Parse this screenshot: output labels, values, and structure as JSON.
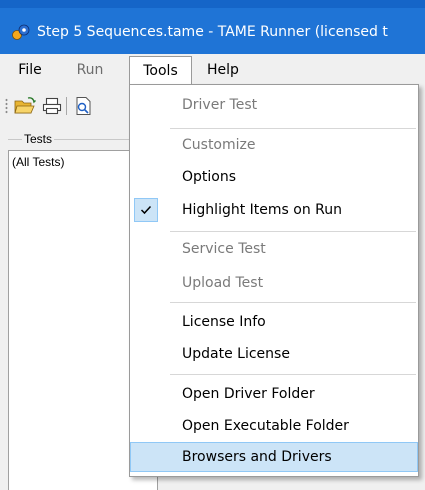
{
  "window": {
    "title": "Step 5 Sequences.tame - TAME Runner (licensed t",
    "icon": "tame-app-icon"
  },
  "menubar": {
    "items": [
      {
        "label": "File",
        "disabled": false
      },
      {
        "label": "Run",
        "disabled": true
      },
      {
        "label": "Tools",
        "open": true
      },
      {
        "label": "Help",
        "disabled": false
      }
    ]
  },
  "toolbar": {
    "buttons": [
      "open-folder-icon",
      "print-icon",
      "find-icon"
    ]
  },
  "tests_panel": {
    "group_label": "Tests",
    "list_items": [
      "(All Tests)"
    ]
  },
  "tools_menu": {
    "items": [
      {
        "label": "Driver Test",
        "disabled": true
      },
      {
        "label": "Customize",
        "disabled": true
      },
      {
        "label": "Options",
        "disabled": false
      },
      {
        "label": "Highlight Items on Run",
        "disabled": false,
        "checked": true
      },
      {
        "label": "Service Test",
        "disabled": true
      },
      {
        "label": "Upload Test",
        "disabled": true
      },
      {
        "label": "License Info",
        "disabled": false
      },
      {
        "label": "Update License",
        "disabled": false
      },
      {
        "label": "Open Driver Folder",
        "disabled": false
      },
      {
        "label": "Open Executable Folder",
        "disabled": false
      },
      {
        "label": "Browsers and Drivers",
        "disabled": false,
        "highlighted": true
      }
    ]
  },
  "colors": {
    "titlebar": "#1f74d6",
    "menu_highlight": "#cce4f7",
    "menu_highlight_border": "#90c8f6",
    "disabled_text": "#7a7a7a"
  }
}
